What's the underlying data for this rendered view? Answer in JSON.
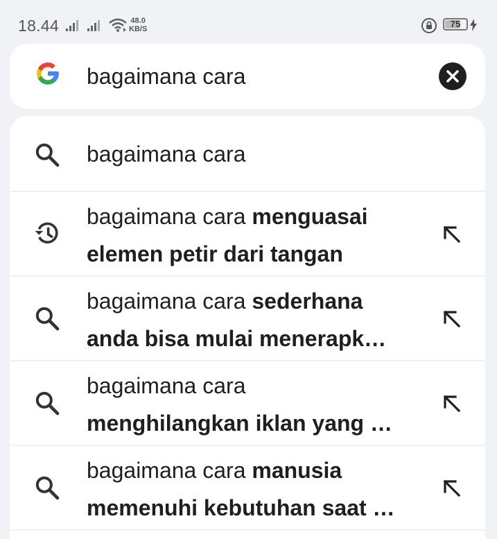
{
  "status_bar": {
    "time": "18.44",
    "net_speed_value": "48.0",
    "net_speed_unit": "KB/S",
    "battery": "75",
    "battery_level": 0.75
  },
  "search": {
    "query": "bagaimana cara",
    "clear_icon": "close-icon",
    "logo": "google-logo"
  },
  "suggestions": [
    {
      "icon": "search-icon",
      "prefix": "bagaimana cara",
      "bold_line1": "",
      "bold_line2": "",
      "fill_arrow": false
    },
    {
      "icon": "history-icon",
      "prefix": "bagaimana cara",
      "bold_line1": "menguasai",
      "bold_line2": "elemen petir dari tangan",
      "fill_arrow": true
    },
    {
      "icon": "search-icon",
      "prefix": "bagaimana cara",
      "bold_line1": "sederhana",
      "bold_line2": "anda bisa mulai menerapk…",
      "fill_arrow": true
    },
    {
      "icon": "search-icon",
      "prefix": "bagaimana cara",
      "bold_line1": "",
      "bold_line2": "menghilangkan iklan yang …",
      "fill_arrow": true
    },
    {
      "icon": "search-icon",
      "prefix": "bagaimana cara",
      "bold_line1": "manusia",
      "bold_line2": "memenuhi kebutuhan saat …",
      "fill_arrow": true
    }
  ],
  "colors": {
    "background": "#f0f2f5",
    "card": "#ffffff",
    "text": "#1f1f1f",
    "google_blue": "#4285f4",
    "google_red": "#ea4335",
    "google_yellow": "#fbbc05",
    "google_green": "#34a853"
  }
}
